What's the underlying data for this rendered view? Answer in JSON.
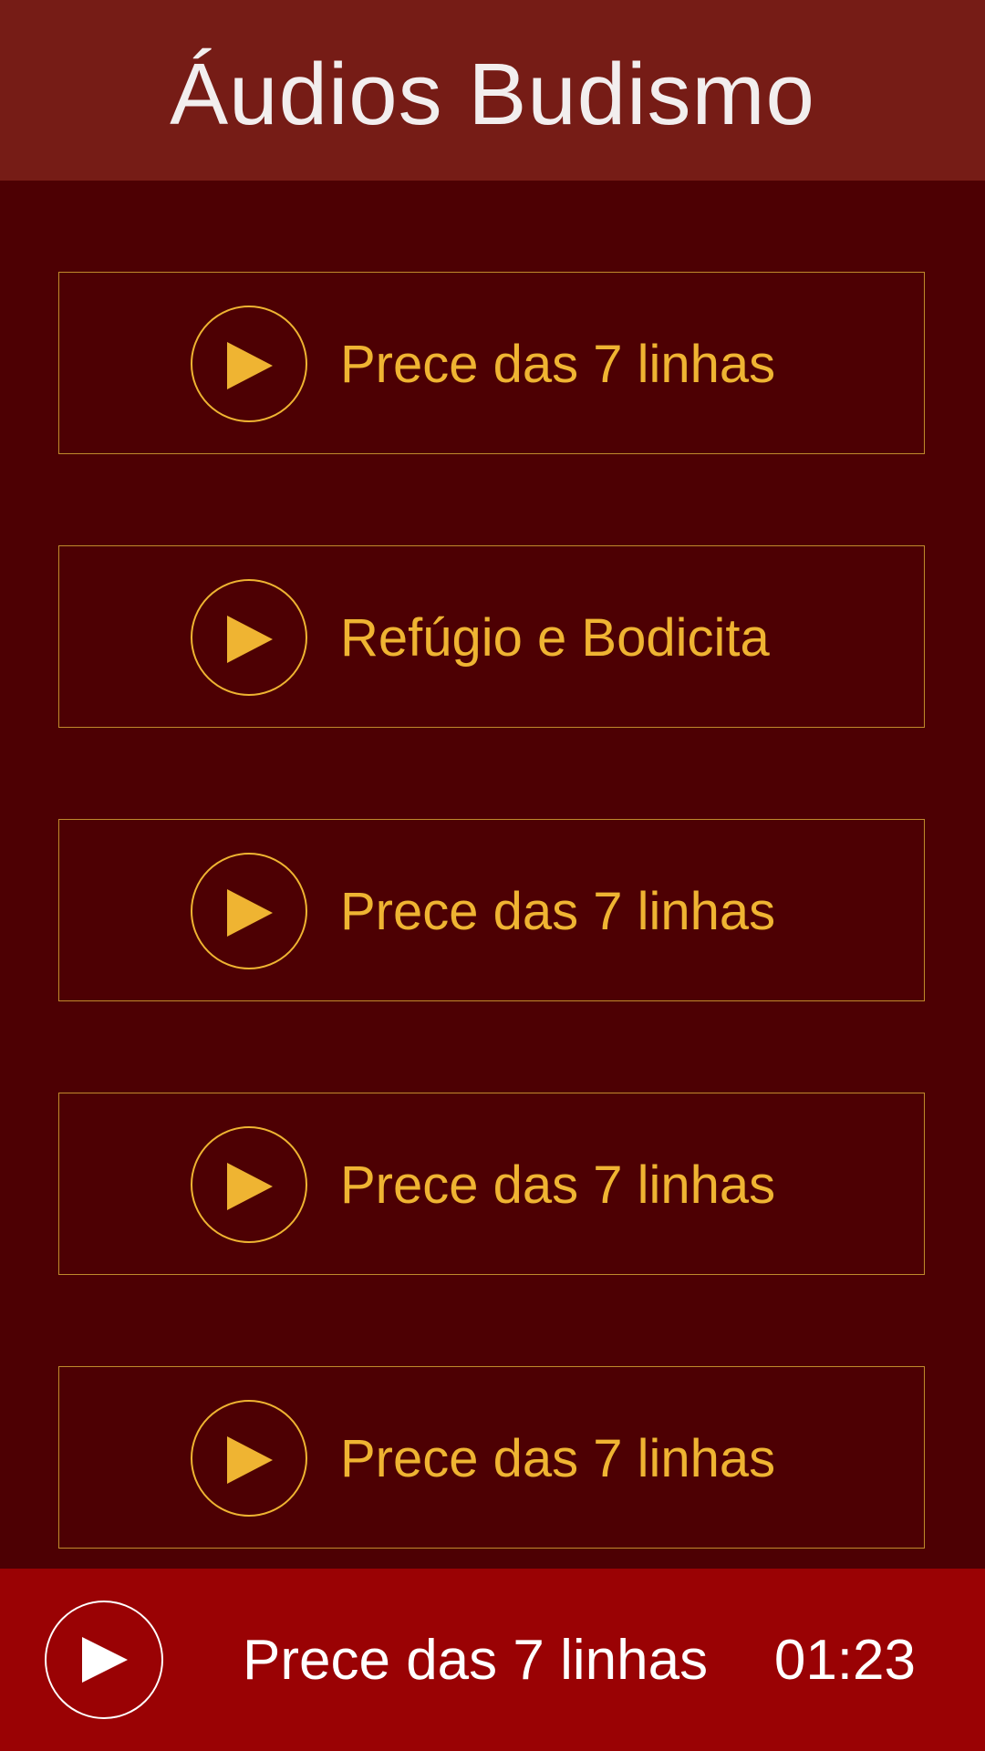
{
  "header": {
    "title": "Áudios Budismo"
  },
  "tracks": [
    {
      "label": "Prece das 7 linhas",
      "icon": "play-icon"
    },
    {
      "label": "Refúgio e Bodicita",
      "icon": "play-icon"
    },
    {
      "label": "Prece das 7 linhas",
      "icon": "play-icon"
    },
    {
      "label": "Prece das 7 linhas",
      "icon": "play-icon"
    },
    {
      "label": "Prece das 7 linhas",
      "icon": "play-icon"
    }
  ],
  "player": {
    "title": "Prece das 7 linhas",
    "time": "01:23",
    "icon": "play-icon"
  },
  "colors": {
    "background": "#4d0003",
    "header": "#761c16",
    "accent": "#efb432",
    "player_bar": "#9a0204"
  }
}
